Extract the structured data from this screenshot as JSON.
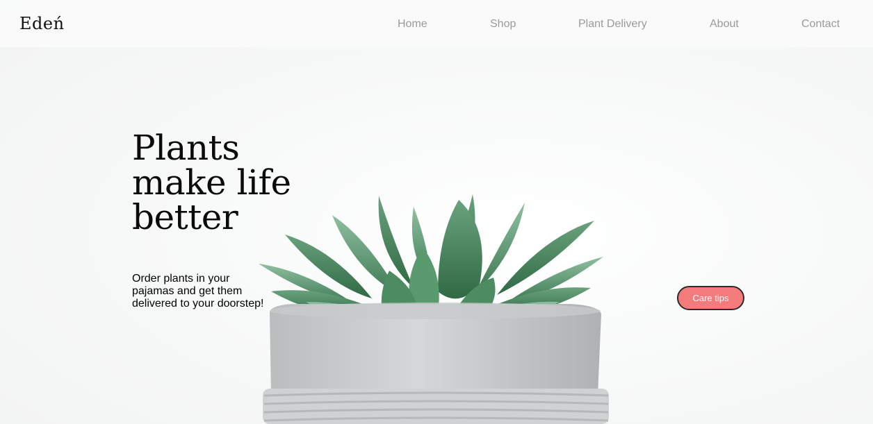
{
  "brand": {
    "logo_text": "Edeń"
  },
  "nav": {
    "items": [
      {
        "label": "Home"
      },
      {
        "label": "Shop"
      },
      {
        "label": "Plant Delivery"
      },
      {
        "label": "About"
      },
      {
        "label": "Contact"
      }
    ]
  },
  "hero": {
    "headline_lines": [
      "Plants",
      "make life",
      "better"
    ],
    "subtext_lines": [
      "Order plants in your",
      "pajamas and get them",
      "delivered to your doorstep!"
    ],
    "cta_label": "Care tips",
    "image_subject": "succulent-in-concrete-pot"
  },
  "colors": {
    "cta_background": "#f47b7b",
    "cta_border": "#2b2b2b",
    "nav_text": "#9a9a9a",
    "headline_text": "#0b0b0b",
    "plant_leaf": "#4f8a63",
    "pot": "#c9cccc"
  }
}
